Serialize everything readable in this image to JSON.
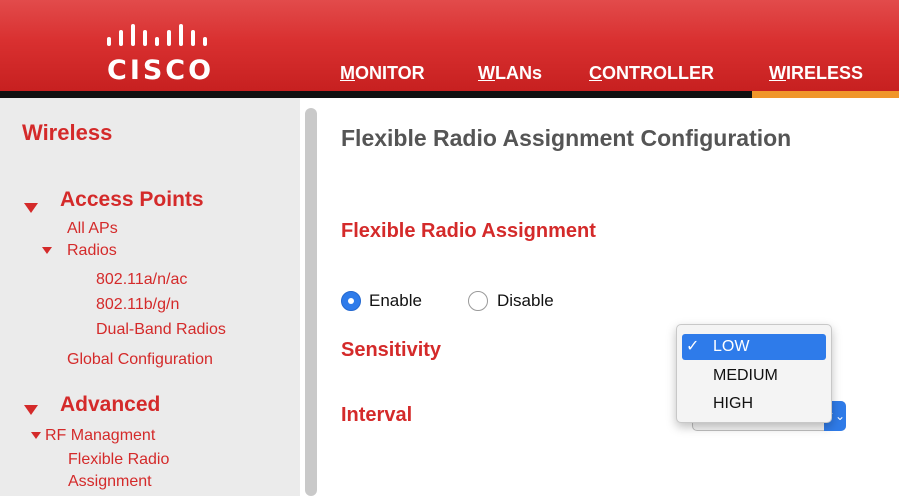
{
  "brand": {
    "logo_text": "CISCO",
    "primary_color": "#d42a2a",
    "accent_color": "#f0962a",
    "select_color": "#2e7bea"
  },
  "nav": {
    "items": [
      {
        "label": "MONITOR"
      },
      {
        "label": "WLANs"
      },
      {
        "label": "CONTROLLER"
      },
      {
        "label": "WIRELESS",
        "active": true
      }
    ]
  },
  "sidebar": {
    "title": "Wireless",
    "sections": [
      {
        "label": "Access Points",
        "expanded": true,
        "links": {
          "all_aps": "All APs",
          "radios": "Radios",
          "radio_80211a": "802.11a/n/ac",
          "radio_80211b": "802.11b/g/n",
          "dual_band": "Dual-Band Radios",
          "global_config": "Global Configuration"
        }
      },
      {
        "label": "Advanced",
        "expanded": true,
        "links": {
          "rf_management": "RF Managment",
          "flexible_radio_line1": "Flexible Radio",
          "flexible_radio_line2": "Assignment"
        }
      }
    ]
  },
  "main": {
    "page_title": "Flexible Radio Assignment Configuration",
    "section_heading": "Flexible Radio Assignment",
    "radio_options": {
      "enable": {
        "label": "Enable",
        "selected": true
      },
      "disable": {
        "label": "Disable",
        "selected": false
      }
    },
    "sensitivity_label": "Sensitivity",
    "interval_label": "Interval",
    "sensitivity_dropdown": {
      "options": [
        "LOW",
        "MEDIUM",
        "HIGH"
      ],
      "selected": "LOW",
      "check_glyph": "✓"
    },
    "interval_select_arrows": "⌃⌄"
  }
}
